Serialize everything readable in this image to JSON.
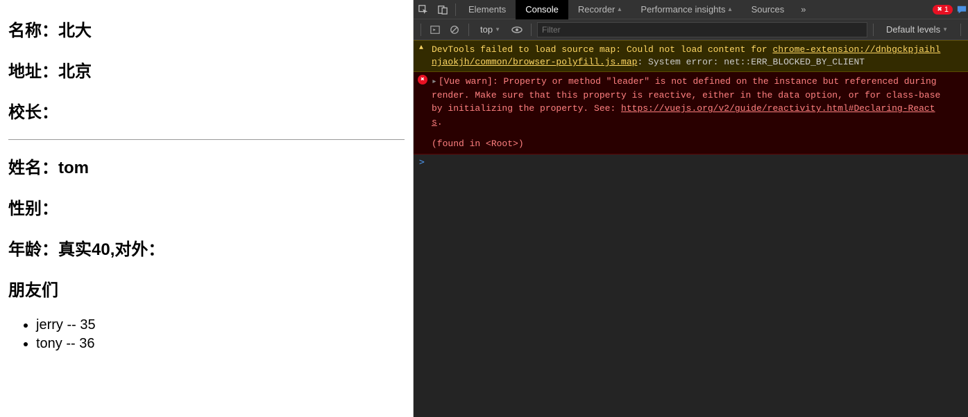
{
  "page": {
    "school": {
      "name_label": "名称：",
      "name_value": "北大",
      "address_label": "地址：",
      "address_value": "北京",
      "leader_label": "校长：",
      "leader_value": ""
    },
    "person": {
      "name_label": "姓名：",
      "name_value": "tom",
      "gender_label": "性别：",
      "gender_value": "",
      "age_label": "年龄：",
      "age_real_prefix": "真实",
      "age_real_value": "40",
      "age_public_prefix": ",对外：",
      "age_public_value": "",
      "friends_label": "朋友们",
      "friends": [
        {
          "text": "jerry -- 35"
        },
        {
          "text": "tony -- 36"
        }
      ]
    }
  },
  "devtools": {
    "tabs": {
      "elements": "Elements",
      "console": "Console",
      "recorder": "Recorder",
      "performance_insights": "Performance insights",
      "sources": "Sources",
      "more": "»"
    },
    "error_count": "1",
    "toolbar": {
      "context": "top",
      "filter_placeholder": "Filter",
      "levels": "Default levels"
    },
    "console": {
      "warn": {
        "prefix": "DevTools failed to load source map: Could not load content for ",
        "link1": "chrome-extension://dnbgckpjaihl",
        "link2": "njaokjh/common/browser-polyfill.js.map",
        "suffix": ": System error: net::ERR_BLOCKED_BY_CLIENT"
      },
      "error": {
        "line1": "[Vue warn]: Property or method \"leader\" is not defined on the instance but referenced during",
        "line2": "render. Make sure that this property is reactive, either in the data option, or for class-base",
        "line3_prefix": "by initializing the property. See: ",
        "line3_link": "https://vuejs.org/v2/guide/reactivity.html#Declaring-React",
        "line4": "s",
        "found": "(found in <Root>)"
      },
      "prompt": ">"
    }
  }
}
